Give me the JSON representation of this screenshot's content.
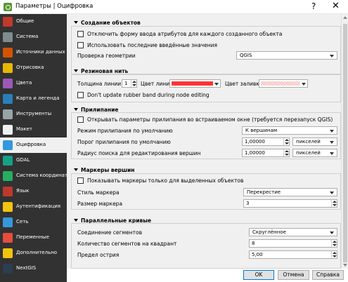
{
  "window": {
    "title": "Параметры | Оцифровка",
    "help_glyph": "?",
    "close_glyph": "✕"
  },
  "sidebar": {
    "items": [
      {
        "label": "Общие",
        "icon": "tools-icon",
        "color": "#c0392b"
      },
      {
        "label": "Система",
        "icon": "system-icon",
        "color": "#7f8c8d"
      },
      {
        "label": "Источники данных",
        "icon": "table-icon",
        "color": "#d35400"
      },
      {
        "label": "Отрисовка",
        "icon": "brush-icon",
        "color": "#e6b800"
      },
      {
        "label": "Цвета",
        "icon": "palette-icon",
        "color": "#9b59b6"
      },
      {
        "label": "Карта и легенда",
        "icon": "map-icon",
        "color": "#2980b9"
      },
      {
        "label": "Инструменты",
        "icon": "wrench-icon",
        "color": "#95a5a6"
      },
      {
        "label": "Макет",
        "icon": "layout-icon",
        "color": "#ecf0f1"
      },
      {
        "label": "Оцифровка",
        "icon": "digitize-icon",
        "color": "#3498db"
      },
      {
        "label": "GDAL",
        "icon": "gdal-icon",
        "color": "#16a085"
      },
      {
        "label": "Система координат",
        "icon": "globe-icon",
        "color": "#27ae60"
      },
      {
        "label": "Язык",
        "icon": "flag-icon",
        "color": "#c0392b"
      },
      {
        "label": "Аутентификация",
        "icon": "lock-icon",
        "color": "#f1c40f"
      },
      {
        "label": "Сеть",
        "icon": "network-icon",
        "color": "#3498db"
      },
      {
        "label": "Переменные",
        "icon": "variables-icon",
        "color": "#e74c3c"
      },
      {
        "label": "Дополнительно",
        "icon": "warning-icon",
        "color": "#f1c40f"
      },
      {
        "label": "NextGIS",
        "icon": "nextgis-icon",
        "color": "#2c3e50"
      }
    ],
    "active_index": 8
  },
  "groups": {
    "create": {
      "title": "Создание объектов",
      "suppress_form_label": "Отключить форму ввода атрибутов для каждого созданного объекта",
      "suppress_form_checked": false,
      "reuse_values_label": "Использовать последние введённые значения",
      "reuse_values_checked": false,
      "geometry_check_label": "Проверка геометрии",
      "geometry_check_value": "QGIS"
    },
    "rubberband": {
      "title": "Резиновая нить",
      "line_width_label": "Толщина линии",
      "line_width_value": "1",
      "line_color_label": "Цвет линии",
      "line_color": "#ff3333",
      "fill_color_label": "Цвет заливки",
      "fill_color": "#f7c9c9",
      "dont_update_label": "Don't update rubber band during node editing",
      "dont_update_checked": false
    },
    "snapping": {
      "title": "Прилипание",
      "open_dock_label": "Открывать параметры прилипания во встраиваемом окне (требуется перезапуск QGIS)",
      "open_dock_checked": false,
      "default_mode_label": "Режим прилипания по умолчанию",
      "default_mode_value": "К вершинам",
      "tolerance_label": "Порог прилипания по умолчанию",
      "tolerance_value": "1,00000",
      "tolerance_unit": "пикселей",
      "radius_label": "Радиус поиска для редактирования вершин",
      "radius_value": "1,00000",
      "radius_unit": "пикселей"
    },
    "markers": {
      "title": "Маркеры вершин",
      "selected_only_label": "Показывать маркеры только для выделенных объектов",
      "selected_only_checked": false,
      "style_label": "Стиль маркера",
      "style_value": "Перекрестие",
      "size_label": "Размер маркера",
      "size_value": "3"
    },
    "offset": {
      "title": "Параллельные кривые",
      "join_label": "Соединение сегментов",
      "join_value": "Скруглённое",
      "quad_segments_label": "Количество сегментов на квадрант",
      "quad_segments_value": "8",
      "miter_label": "Предел острия",
      "miter_value": "5,00"
    }
  },
  "buttons": {
    "ok": "OK",
    "cancel": "Отмена",
    "help": "Справка"
  }
}
